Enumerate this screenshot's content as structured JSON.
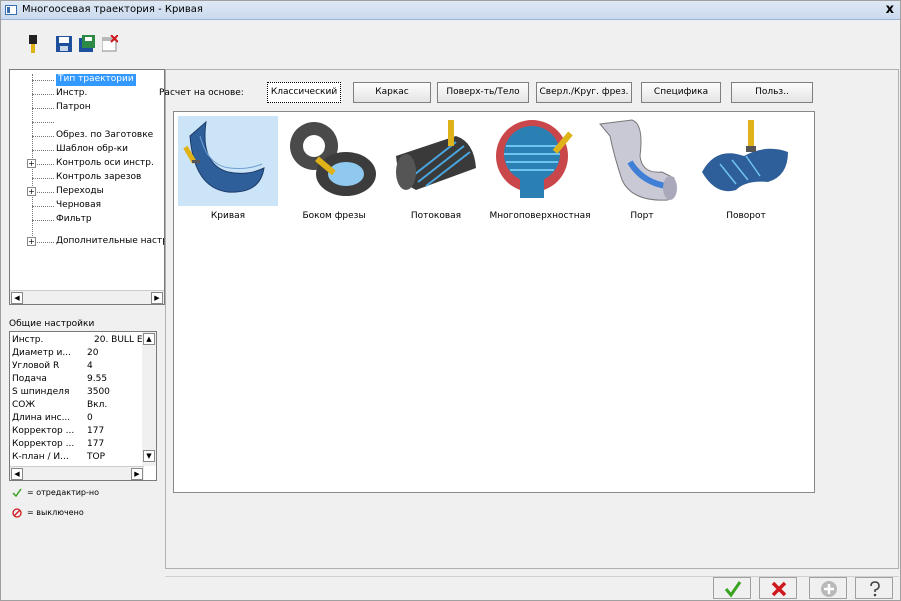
{
  "window": {
    "title": "Многоосевая траектория - Кривая",
    "close_label": "x"
  },
  "tree": {
    "items": [
      {
        "label": "Тип траектории",
        "selected": true
      },
      {
        "label": "Инстр."
      },
      {
        "label": "Патрон"
      },
      {
        "label": ""
      },
      {
        "label": "Обрез. по Заготовке"
      },
      {
        "label": "Шаблон обр-ки"
      },
      {
        "label": "Контроль оси инстр.",
        "expandable": true
      },
      {
        "label": "Контроль зарезов"
      },
      {
        "label": "Переходы",
        "expandable": true
      },
      {
        "label": "Черновая"
      },
      {
        "label": "Фильтр"
      },
      {
        "label": ""
      },
      {
        "label": "Дополнительные настр",
        "expandable": true
      }
    ],
    "expand_glyph": "+"
  },
  "general": {
    "title": "Общие настройки",
    "props": [
      {
        "name": "Инстр.",
        "value": "20. BULL E"
      },
      {
        "name": "Диаметр и...",
        "value": "20"
      },
      {
        "name": "Угловой R",
        "value": "4"
      },
      {
        "name": "Подача",
        "value": "9.55"
      },
      {
        "name": "S шпинделя",
        "value": "3500"
      },
      {
        "name": "СОЖ",
        "value": "Вкл."
      },
      {
        "name": "Длина инс...",
        "value": "0"
      },
      {
        "name": "Корректор ...",
        "value": "177"
      },
      {
        "name": "Корректор ...",
        "value": "177"
      },
      {
        "name": "К-план / И...",
        "value": "TOP"
      }
    ]
  },
  "legend": {
    "edited": "= отредактир-но",
    "disabled": "= выключено"
  },
  "calc": {
    "label": "Расчет на основе:",
    "tabs": [
      {
        "label": "Классический",
        "active": true
      },
      {
        "label": "Каркас"
      },
      {
        "label": "Поверх-ть/Тело"
      },
      {
        "label": "Сверл./Круг. фрез."
      },
      {
        "label": "Специфика"
      },
      {
        "label": "Польз.."
      }
    ]
  },
  "gallery": {
    "items": [
      {
        "label": "Кривая",
        "selected": true
      },
      {
        "label": "Боком фрезы"
      },
      {
        "label": "Потоковая"
      },
      {
        "label": "Многоповерхностная"
      },
      {
        "label": "Порт"
      },
      {
        "label": "Поворот"
      }
    ]
  },
  "colors": {
    "accent": "#3399ff",
    "ok": "#3aa320",
    "cancel": "#d0191f",
    "part_blue": "#2f5f9a",
    "tool_yellow": "#e0b21a"
  }
}
